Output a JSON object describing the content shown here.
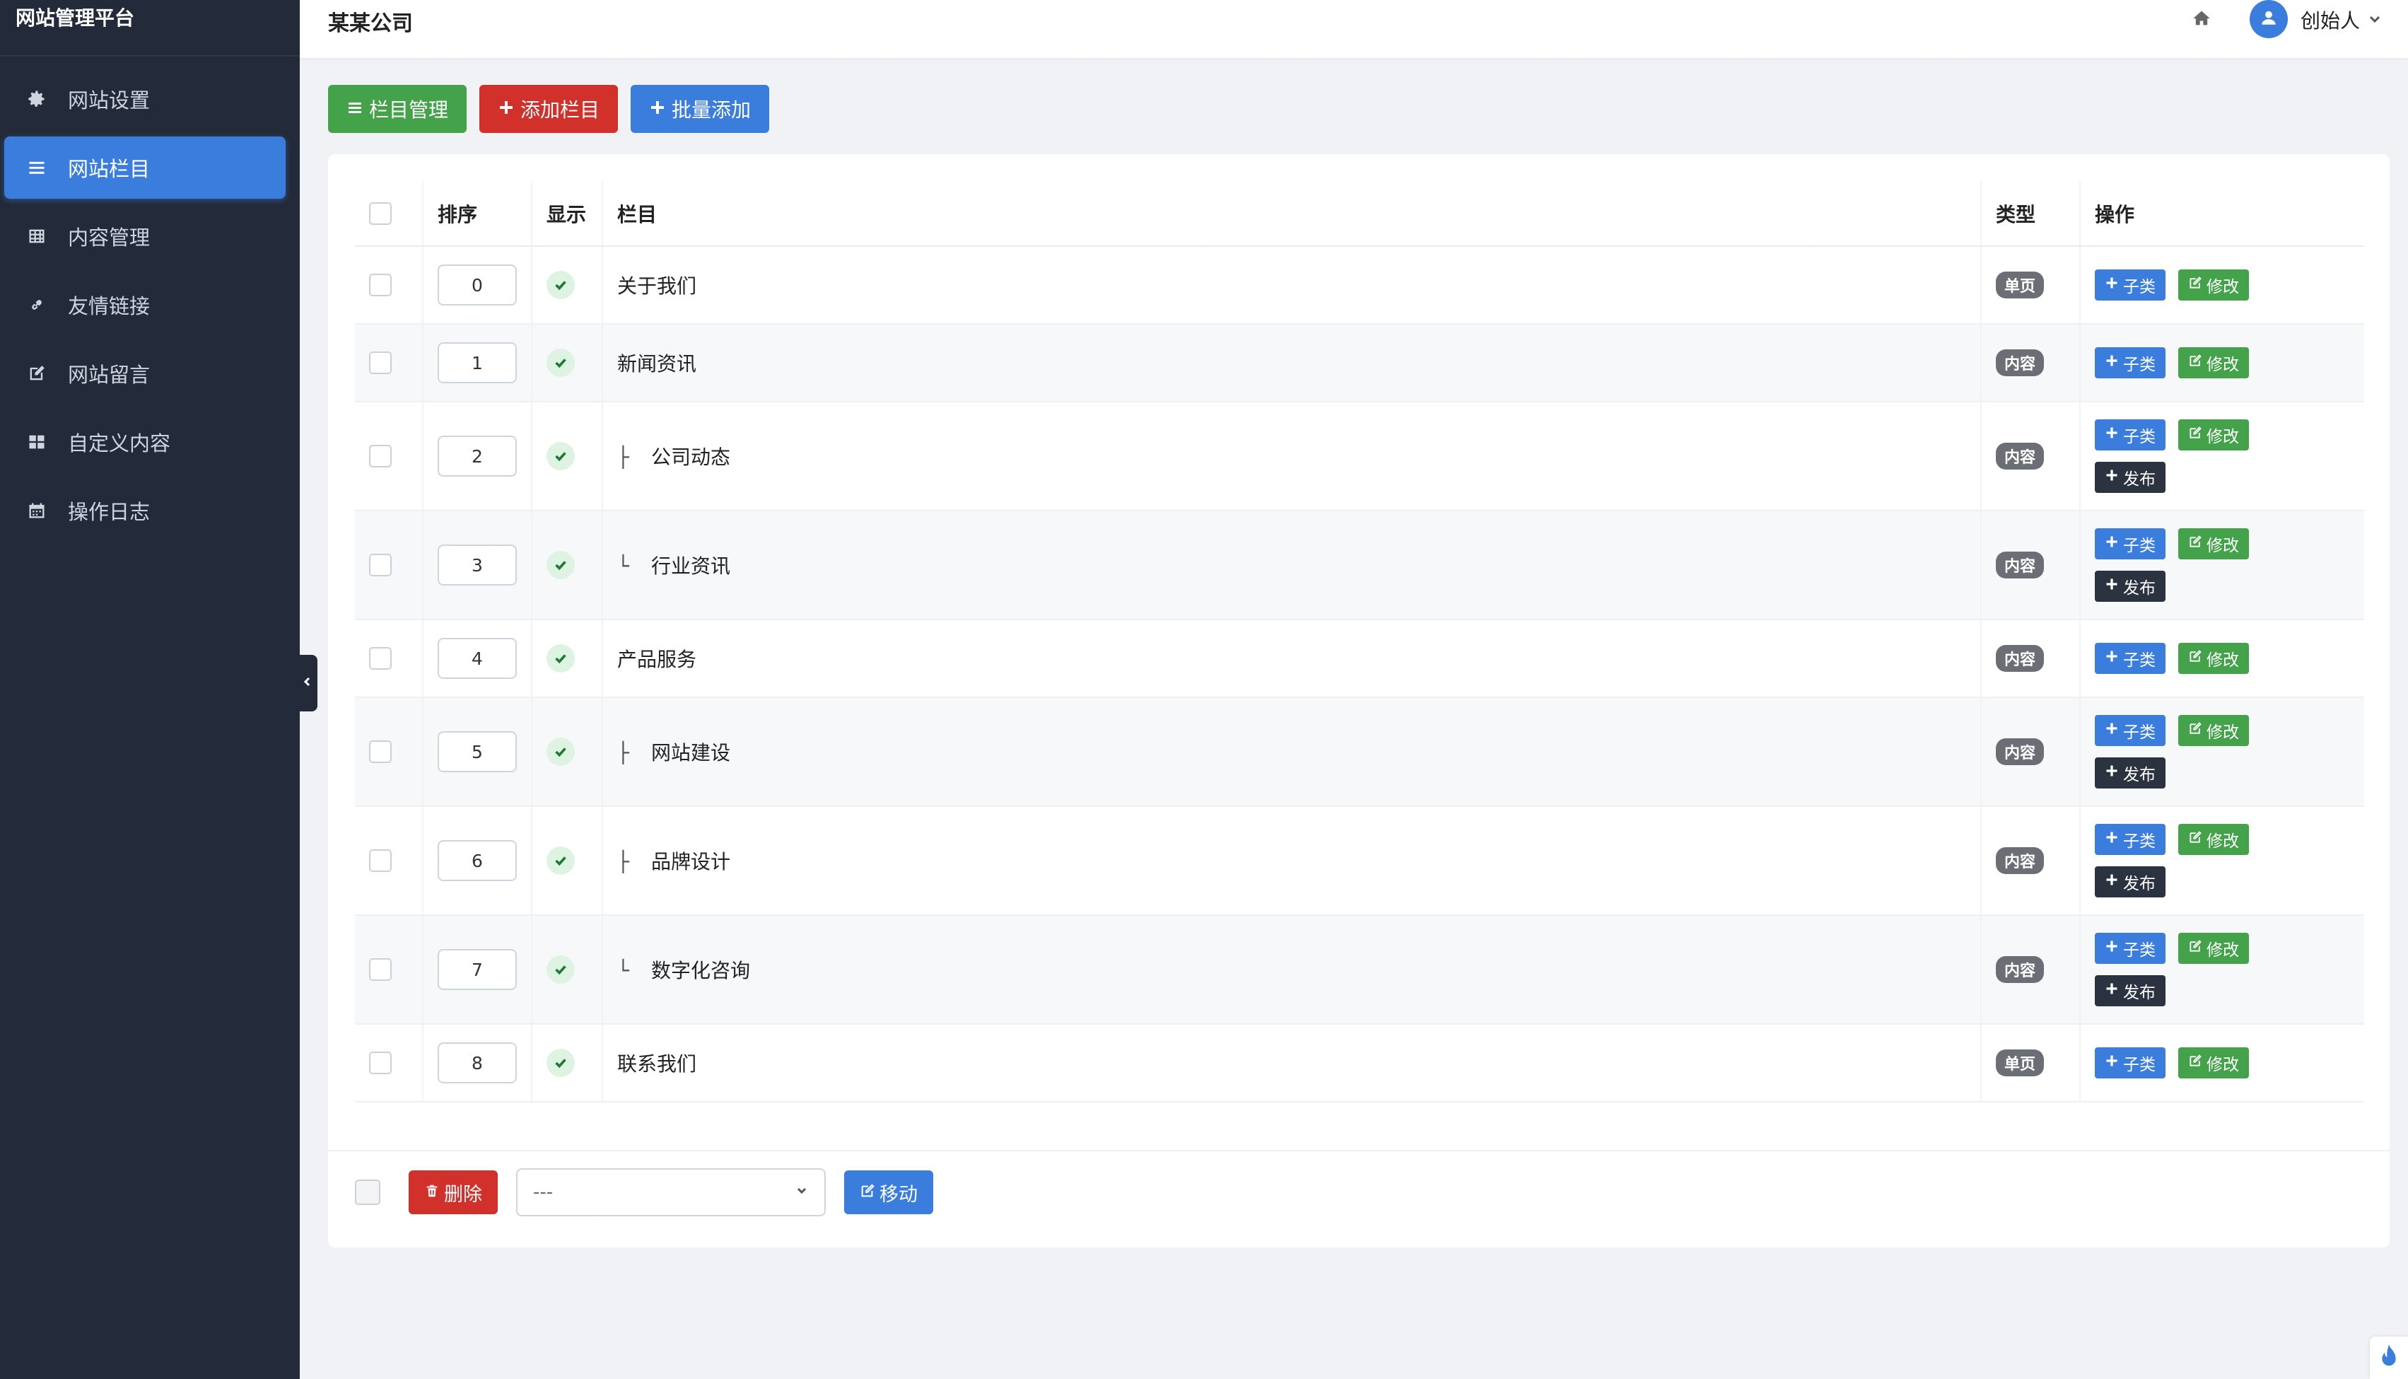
{
  "sidebar": {
    "brand": "网站管理平台",
    "items": [
      {
        "label": "网站设置",
        "icon": "gear-icon"
      },
      {
        "label": "网站栏目",
        "icon": "list-icon",
        "active": true
      },
      {
        "label": "内容管理",
        "icon": "table-icon"
      },
      {
        "label": "友情链接",
        "icon": "link-icon"
      },
      {
        "label": "网站留言",
        "icon": "edit-icon"
      },
      {
        "label": "自定义内容",
        "icon": "grid-icon"
      },
      {
        "label": "操作日志",
        "icon": "calendar-icon"
      }
    ]
  },
  "header": {
    "company": "某某公司",
    "username": "创始人"
  },
  "toolbar": {
    "manage_label": "栏目管理",
    "add_label": "添加栏目",
    "batch_label": "批量添加"
  },
  "table": {
    "headers": {
      "sort": "排序",
      "show": "显示",
      "column": "栏目",
      "type": "类型",
      "ops": "操作"
    },
    "rows": [
      {
        "sort": "0",
        "name": "关于我们",
        "tree": "",
        "type": "单页"
      },
      {
        "sort": "1",
        "name": "新闻资讯",
        "tree": "",
        "type": "内容"
      },
      {
        "sort": "2",
        "name": "公司动态",
        "tree": "├",
        "type": "内容"
      },
      {
        "sort": "3",
        "name": "行业资讯",
        "tree": "└",
        "type": "内容"
      },
      {
        "sort": "4",
        "name": "产品服务",
        "tree": "",
        "type": "内容"
      },
      {
        "sort": "5",
        "name": "网站建设",
        "tree": "├",
        "type": "内容"
      },
      {
        "sort": "6",
        "name": "品牌设计",
        "tree": "├",
        "type": "内容"
      },
      {
        "sort": "7",
        "name": "数字化咨询",
        "tree": "└",
        "type": "内容"
      },
      {
        "sort": "8",
        "name": "联系我们",
        "tree": "",
        "type": "单页"
      }
    ],
    "ops": {
      "child_label": "子类",
      "edit_label": "修改",
      "publish_label": "发布"
    }
  },
  "footer": {
    "delete_label": "删除",
    "select_value": "---",
    "move_label": "移动"
  },
  "colors": {
    "sidebar_bg": "#232b3a",
    "accent": "#3b7ddd",
    "green": "#44a34a",
    "red": "#d2302b"
  }
}
